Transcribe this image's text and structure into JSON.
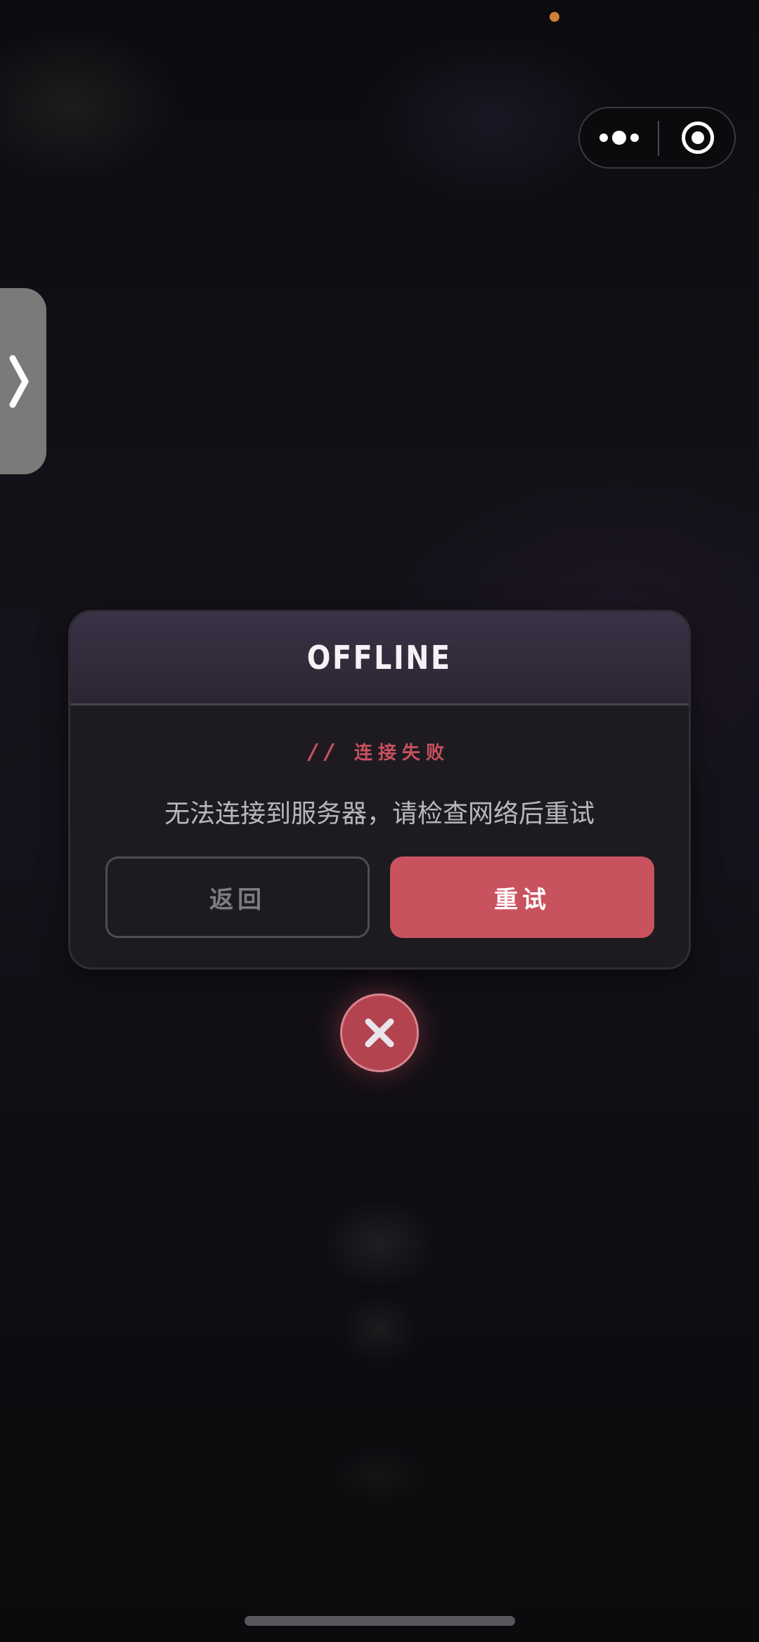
{
  "dialog": {
    "title": "OFFLINE",
    "tag_slashes": "//",
    "tag_text": "连接失败",
    "message": "无法连接到服务器，请检查网络后重试",
    "back_label": "返回",
    "retry_label": "重试"
  },
  "icons": {
    "capsule_more": "more-dots-icon",
    "capsule_close": "target-ring-icon",
    "side_tab": "chevron-right-icon",
    "close_fab": "close-x-icon"
  },
  "colors": {
    "accent": "#c9525f",
    "error_text": "#c9505e",
    "status_dot": "#d08038",
    "header_gradient_top": "#3a3245"
  }
}
